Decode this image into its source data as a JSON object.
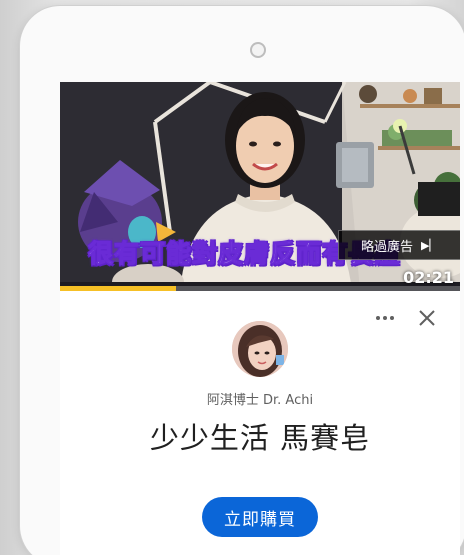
{
  "video": {
    "caption": "很有可能對皮膚反而有長痘",
    "skip_ad_label": "略過廣告",
    "skip_icon": "play-next-icon",
    "duration": "02:21",
    "progress_fraction": 0.29
  },
  "ad_panel": {
    "more_icon": "more-horiz-icon",
    "close_icon": "close-icon",
    "channel_name": "阿淇博士 Dr. Achi",
    "product_title": "少少生活 馬賽皂",
    "cta_label": "立即購買"
  },
  "colors": {
    "cta_background": "#0b66d8",
    "progress_bar": "#f6c026",
    "caption_outline": "#6a2bd6"
  }
}
